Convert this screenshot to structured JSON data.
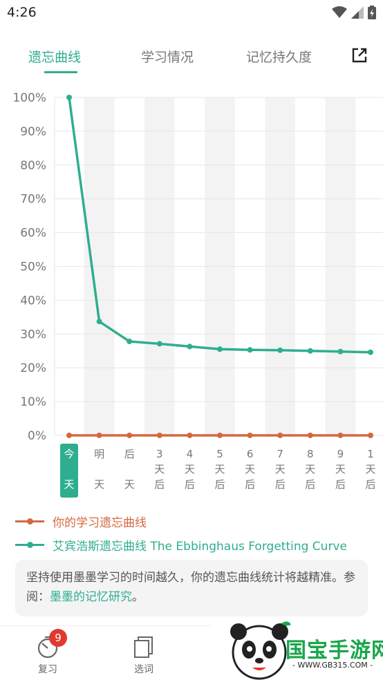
{
  "status_bar": {
    "time": "4:26",
    "icons": [
      "wifi-icon",
      "signal-icon",
      "battery-icon"
    ]
  },
  "tabs": [
    {
      "label": "遗忘曲线",
      "active": true
    },
    {
      "label": "学习情况",
      "active": false
    },
    {
      "label": "记忆持久度",
      "active": false
    }
  ],
  "share_icon": "external-link-icon",
  "colors": {
    "accent": "#2fae8f",
    "user_curve": "#d4683f",
    "badge": "#e03a2f",
    "watermark": "#19a64a"
  },
  "chart_data": {
    "type": "line",
    "y_ticks": [
      "100%",
      "90%",
      "80%",
      "70%",
      "60%",
      "50%",
      "40%",
      "30%",
      "20%",
      "10%",
      "0%"
    ],
    "ylim": [
      0,
      100
    ],
    "categories": [
      "今天",
      "明天",
      "后天",
      "3天后",
      "4天后",
      "5天后",
      "6天后",
      "7天后",
      "8天后",
      "9天后",
      "1天后"
    ],
    "selected_category": 0,
    "series": [
      {
        "name": "你的学习遗忘曲线",
        "color": "#d4683f",
        "values": [
          0,
          0,
          0,
          0,
          0,
          0,
          0,
          0,
          0,
          0,
          0
        ]
      },
      {
        "name": "艾宾浩斯遗忘曲线 The Ebbinghaus Forgetting Curve",
        "color": "#2fae8f",
        "values": [
          100,
          33.7,
          27.8,
          27.1,
          26.3,
          25.5,
          25.3,
          25.2,
          25.0,
          24.8,
          24.6
        ]
      }
    ],
    "grid": true
  },
  "note": {
    "text": "坚持使用墨墨学习的时间越久，你的遗忘曲线统计将越精准。参阅：",
    "link": "墨墨的记忆研究",
    "end": "。"
  },
  "bottom_nav": [
    {
      "label": "复习",
      "icon": "timer-icon",
      "badge": "9"
    },
    {
      "label": "选词",
      "icon": "cards-icon"
    }
  ],
  "watermark": {
    "brand": "国宝手游网",
    "url": "- WWW.GB315.COM -"
  }
}
